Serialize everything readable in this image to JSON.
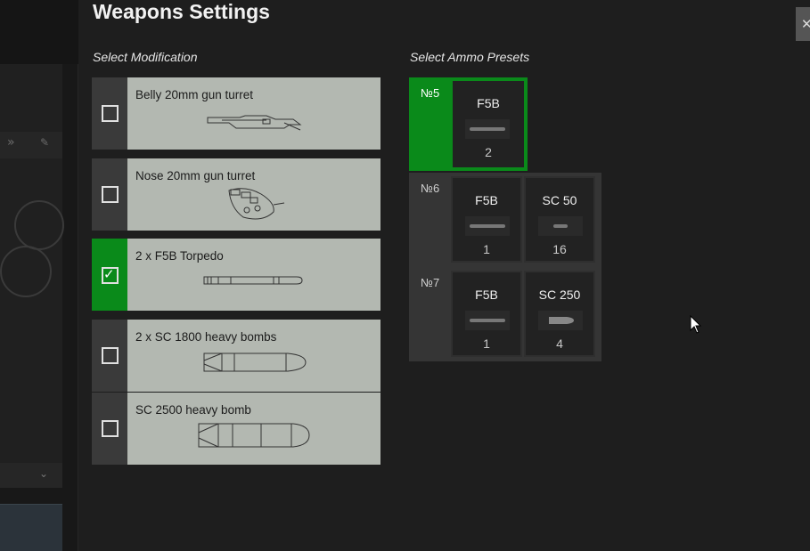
{
  "dialog": {
    "title": "Weapons Settings",
    "close_glyph": "✕"
  },
  "modifications": {
    "label": "Select Modification",
    "items": [
      {
        "name": "Belly 20mm gun turret",
        "selected": false,
        "icon": "belly-turret-icon"
      },
      {
        "name": "Nose 20mm gun turret",
        "selected": false,
        "icon": "nose-turret-icon"
      },
      {
        "name": "2 x F5B Torpedo",
        "selected": true,
        "icon": "torpedo-icon"
      },
      {
        "name": "2 x SC 1800 heavy bombs",
        "selected": false,
        "icon": "heavy-bomb-icon"
      },
      {
        "name": "SC 2500 heavy bomb",
        "selected": false,
        "icon": "heavy-bomb-icon"
      }
    ]
  },
  "ammo_presets": {
    "label": "Select Ammo Presets",
    "presets": [
      {
        "number": "№5",
        "selected": true,
        "slots": [
          {
            "name": "F5B",
            "count": "2"
          }
        ]
      },
      {
        "number": "№6",
        "selected": false,
        "slots": [
          {
            "name": "F5B",
            "count": "1"
          },
          {
            "name": "SC 50",
            "count": "16"
          }
        ]
      },
      {
        "number": "№7",
        "selected": false,
        "slots": [
          {
            "name": "F5B",
            "count": "1"
          },
          {
            "name": "SC 250",
            "count": "4"
          }
        ]
      }
    ]
  },
  "colors": {
    "accent_selected": "#0a8a1a",
    "card_background": "#b3b8b1",
    "panel_background": "#1e1e1e"
  }
}
